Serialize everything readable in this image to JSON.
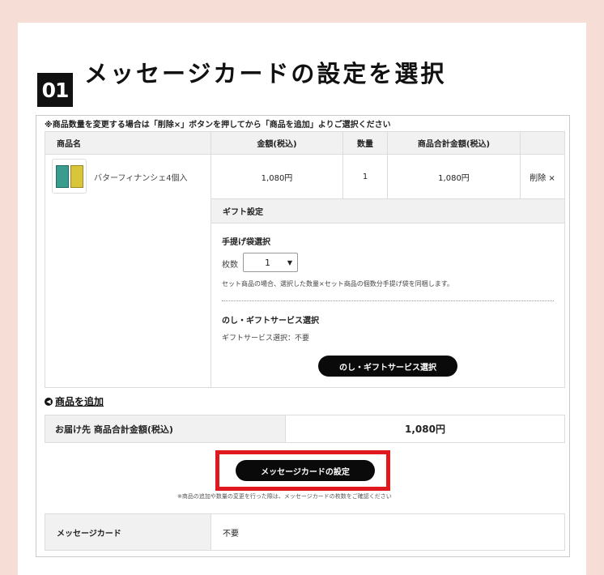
{
  "step": {
    "number": "01",
    "title": "メッセージカードの設定を選択"
  },
  "notice": "※商品数量を変更する場合は「削除×」ボタンを押してから「商品を追加」よりご選択ください",
  "table": {
    "headers": {
      "product": "商品名",
      "price": "金額(税込)",
      "qty": "数量",
      "subtotal": "商品合計金額(税込)"
    },
    "row": {
      "name": "バターフィナンシェ4個入",
      "price": "1,080円",
      "qty": "1",
      "subtotal": "1,080円",
      "delete": "削除 ×"
    }
  },
  "gift": {
    "header": "ギフト設定",
    "bag_title": "手提げ袋選択",
    "count_label": "枚数",
    "count_value": "1",
    "bag_note": "セット商品の場合、選択した数量×セット商品の個数分手提げ袋を同梱します。",
    "service_title": "のし・ギフトサービス選択",
    "service_status": "ギフトサービス選択：不要",
    "service_button": "のし・ギフトサービス選択"
  },
  "add_product": "商品を追加",
  "total": {
    "label": "お届け先 商品合計金額(税込)",
    "value": "1,080円"
  },
  "message_button": "メッセージカードの設定",
  "message_note": "※商品の追加や数量の変更を行った際は、メッセージカードの枚数をご確認ください",
  "message_card": {
    "label": "メッセージカード",
    "value": "不要"
  },
  "colors": {
    "background": "#f6ded7",
    "highlight": "#e0191f",
    "button": "#0a0a0a"
  }
}
